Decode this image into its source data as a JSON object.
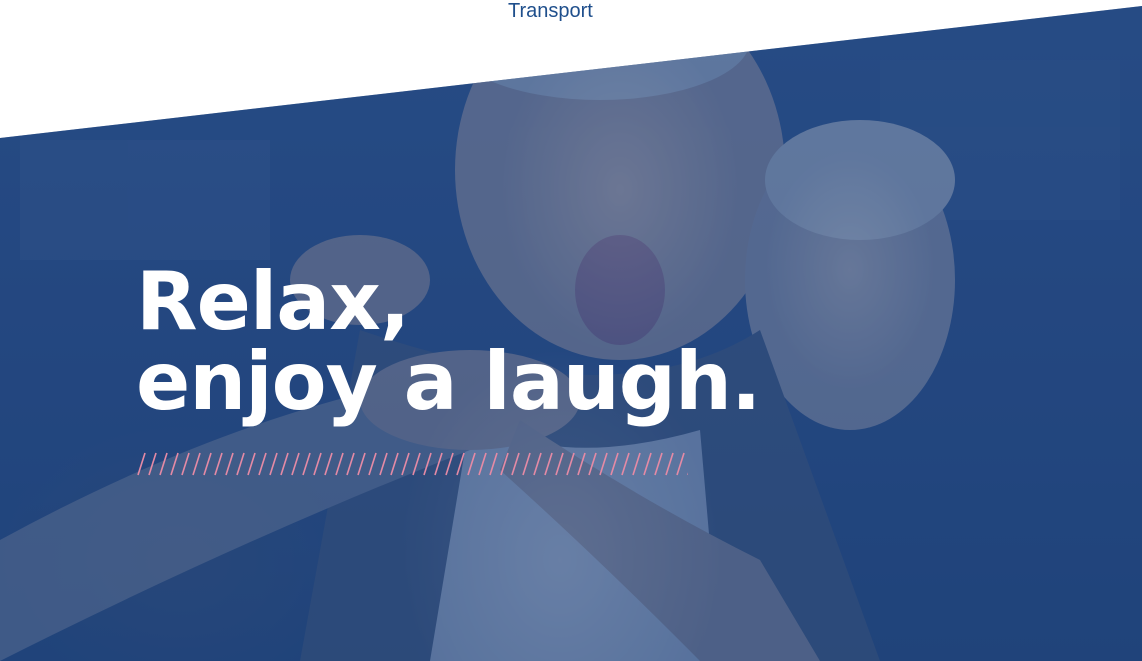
{
  "header": {
    "nav_label": "Transport"
  },
  "hero": {
    "headline_line1": "Relax,",
    "headline_line2": "enjoy a laugh.",
    "divider_color": "#e58aa5",
    "overlay_color": "#1c4282"
  },
  "colors": {
    "nav_text": "#1f4f8c",
    "headline_text": "#ffffff"
  }
}
